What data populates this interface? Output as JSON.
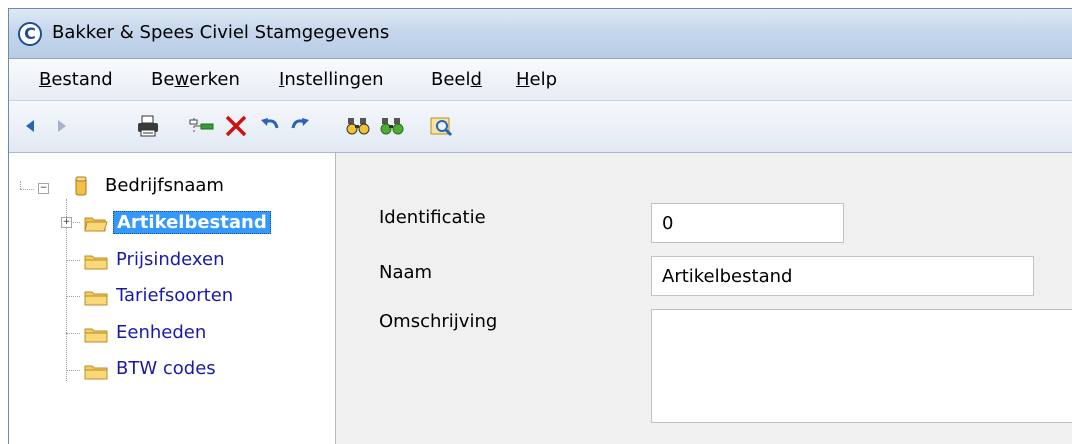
{
  "window": {
    "title": "Bakker & Spees Civiel Stamgegevens",
    "app_icon_letter": "C"
  },
  "menubar": {
    "items": [
      {
        "label": "Bestand",
        "mnemonic_index": 0
      },
      {
        "label": "Bewerken",
        "mnemonic_index": 2
      },
      {
        "label": "Instellingen",
        "mnemonic_index": 0
      },
      {
        "label": "Beeld",
        "mnemonic_index": 4
      },
      {
        "label": "Help",
        "mnemonic_index": 0
      }
    ]
  },
  "toolbar": {
    "buttons": [
      {
        "icon": "back-arrow-icon"
      },
      {
        "icon": "forward-arrow-icon"
      },
      {
        "icon": "printer-icon"
      },
      {
        "icon": "insert-record-icon"
      },
      {
        "icon": "delete-icon"
      },
      {
        "icon": "undo-icon"
      },
      {
        "icon": "redo-icon"
      },
      {
        "icon": "find-icon"
      },
      {
        "icon": "find-next-icon"
      },
      {
        "icon": "search-folder-icon"
      }
    ]
  },
  "tree": {
    "root": {
      "label": "Bedrijfsnaam",
      "icon": "database-icon"
    },
    "items": [
      {
        "label": "Artikelbestand",
        "selected": true,
        "has_children": true,
        "icon": "open-folder-icon"
      },
      {
        "label": "Prijsindexen",
        "selected": false,
        "has_children": false,
        "icon": "folder-icon"
      },
      {
        "label": "Tariefsoorten",
        "selected": false,
        "has_children": false,
        "icon": "folder-icon"
      },
      {
        "label": "Eenheden",
        "selected": false,
        "has_children": false,
        "icon": "folder-icon"
      },
      {
        "label": "BTW codes",
        "selected": false,
        "has_children": false,
        "icon": "folder-icon"
      }
    ]
  },
  "form": {
    "identificatie": {
      "label": "Identificatie",
      "value": "0"
    },
    "naam": {
      "label": "Naam",
      "value": "Artikelbestand"
    },
    "omschrijving": {
      "label": "Omschrijving",
      "value": ""
    }
  },
  "colors": {
    "selection": "#3399ff",
    "tree_link": "#1a1aa8",
    "delete_red": "#cc1111",
    "nav_blue": "#2a62b8"
  }
}
